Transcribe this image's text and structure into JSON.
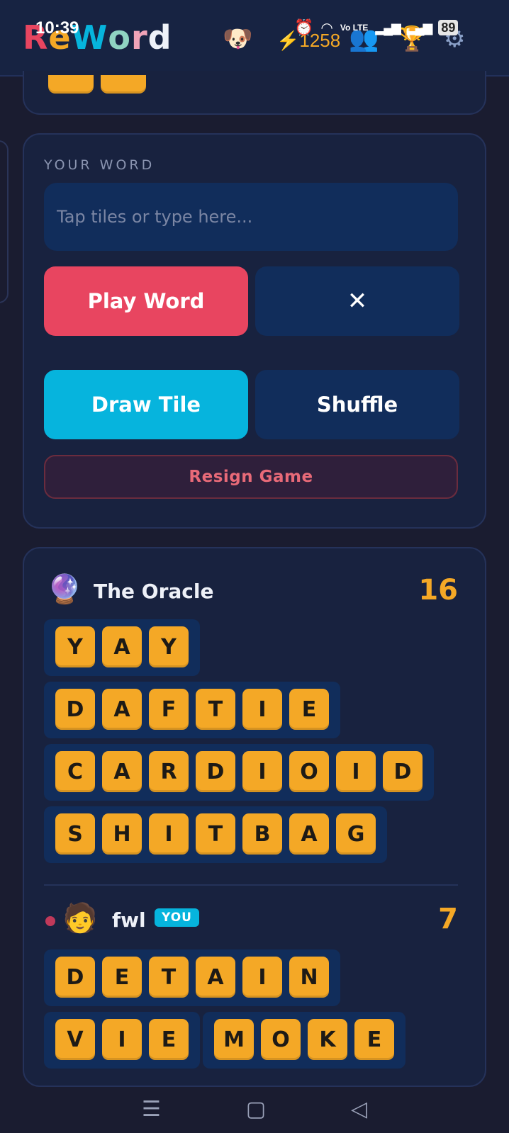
{
  "status_bar": {
    "time": "10:39",
    "network": "Vo LTE",
    "battery": "89"
  },
  "header": {
    "logo_letters": [
      "R",
      "e",
      "W",
      "o",
      "r",
      "d"
    ],
    "logo_colors": [
      "#e84560",
      "#f4a826",
      "#06b4dd",
      "#8fd3c2",
      "#f0a3b8",
      "#eef1f8"
    ],
    "energy_count": "1258",
    "icons": [
      "dog-avatar-icon",
      "lightning-icon",
      "friends-icon",
      "trophy-icon",
      "settings-icon"
    ]
  },
  "input_panel": {
    "label": "YOUR WORD",
    "placeholder": "Tap tiles or type here...",
    "play_label": "Play Word",
    "clear_label": "✕",
    "draw_label": "Draw Tile",
    "shuffle_label": "Shuffle",
    "resign_label": "Resign Game"
  },
  "players": [
    {
      "name": "The Oracle",
      "avatar": "🔮",
      "score": "16",
      "words": [
        [
          "Y",
          "A",
          "Y"
        ],
        [
          "D",
          "A",
          "F",
          "T",
          "I",
          "E"
        ],
        [
          "C",
          "A",
          "R",
          "D",
          "I",
          "O",
          "I",
          "D"
        ],
        [
          "S",
          "H",
          "I",
          "T",
          "B",
          "A",
          "G"
        ]
      ]
    },
    {
      "name": "fwl",
      "avatar": "🧑",
      "badge": "YOU",
      "score": "7",
      "words": [
        [
          "D",
          "E",
          "T",
          "A",
          "I",
          "N"
        ],
        [
          "V",
          "I",
          "E"
        ],
        [
          "M",
          "O",
          "K",
          "E"
        ]
      ]
    }
  ],
  "system_nav": {
    "menu": "☰",
    "home": "▢",
    "back": "◁"
  },
  "colors": {
    "tile": "#f4a826",
    "accent_red": "#e84560",
    "accent_cyan": "#06b4dd",
    "panel": "#18223f"
  }
}
